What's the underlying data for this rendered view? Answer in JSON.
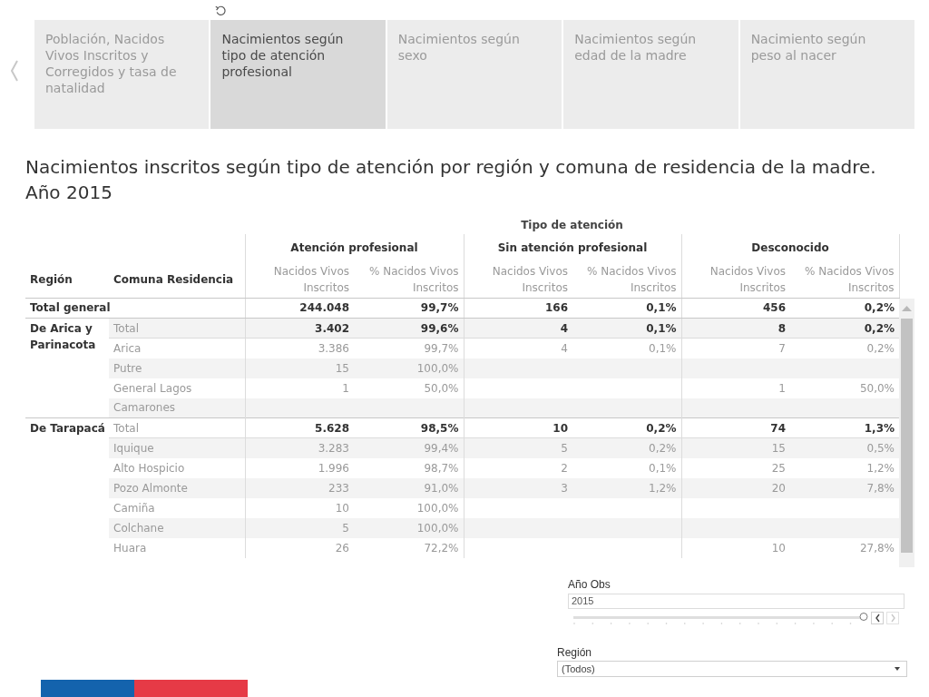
{
  "tabs": [
    {
      "label": "Población, Nacidos Vivos Inscritos y Corregidos y tasa de natalidad",
      "selected": false
    },
    {
      "label": "Nacimientos según tipo de atención profesional",
      "selected": true
    },
    {
      "label": "Nacimientos según sexo",
      "selected": false
    },
    {
      "label": "Nacimientos según edad de la madre",
      "selected": false
    },
    {
      "label": "Nacimiento según peso al nacer",
      "selected": false
    }
  ],
  "title_lines": [
    "Nacimientos inscritos según tipo de atención por región y comuna de residencia de la madre.",
    "Año 2015"
  ],
  "table": {
    "super_header": "Tipo de atención",
    "row_headers": [
      "Región",
      "Comuna Residencia"
    ],
    "groups": [
      {
        "label": "Atención profesional",
        "measures": [
          "Nacidos Vivos Inscritos",
          "% Nacidos Vivos Inscritos"
        ]
      },
      {
        "label": "Sin atención profesional",
        "measures": [
          "Nacidos Vivos Inscritos",
          "% Nacidos Vivos Inscritos"
        ]
      },
      {
        "label": "Desconocido",
        "measures": [
          "Nacidos Vivos Inscritos",
          "% Nacidos Vivos Inscritos"
        ]
      }
    ],
    "grand_total": {
      "label": "Total general",
      "profesional": {
        "count": "244.048",
        "percent": "99,7%"
      },
      "sin_profesional": {
        "count": "166",
        "percent": "0,1%"
      },
      "desconocido": {
        "count": "456",
        "percent": "0,2%"
      }
    },
    "regions": [
      {
        "region": "De Arica y Parinacota",
        "rows": [
          {
            "comuna": "Total",
            "kind": "subtotal",
            "profesional": {
              "count": "3.402",
              "percent": "99,6%"
            },
            "sin_profesional": {
              "count": "4",
              "percent": "0,1%"
            },
            "desconocido": {
              "count": "8",
              "percent": "0,2%"
            }
          },
          {
            "comuna": "Arica",
            "kind": "comuna",
            "profesional": {
              "count": "3.386",
              "percent": "99,7%"
            },
            "sin_profesional": {
              "count": "4",
              "percent": "0,1%"
            },
            "desconocido": {
              "count": "7",
              "percent": "0,2%"
            }
          },
          {
            "comuna": "Putre",
            "kind": "comuna",
            "profesional": {
              "count": "15",
              "percent": "100,0%"
            }
          },
          {
            "comuna": "General Lagos",
            "kind": "comuna",
            "profesional": {
              "count": "1",
              "percent": "50,0%"
            },
            "desconocido": {
              "count": "1",
              "percent": "50,0%"
            }
          },
          {
            "comuna": "Camarones",
            "kind": "comuna"
          }
        ]
      },
      {
        "region": "De Tarapacá",
        "rows": [
          {
            "comuna": "Total",
            "kind": "subtotal",
            "profesional": {
              "count": "5.628",
              "percent": "98,5%"
            },
            "sin_profesional": {
              "count": "10",
              "percent": "0,2%"
            },
            "desconocido": {
              "count": "74",
              "percent": "1,3%"
            }
          },
          {
            "comuna": "Iquique",
            "kind": "comuna",
            "profesional": {
              "count": "3.283",
              "percent": "99,4%"
            },
            "sin_profesional": {
              "count": "5",
              "percent": "0,2%"
            },
            "desconocido": {
              "count": "15",
              "percent": "0,5%"
            }
          },
          {
            "comuna": "Alto Hospicio",
            "kind": "comuna",
            "profesional": {
              "count": "1.996",
              "percent": "98,7%"
            },
            "sin_profesional": {
              "count": "2",
              "percent": "0,1%"
            },
            "desconocido": {
              "count": "25",
              "percent": "1,2%"
            }
          },
          {
            "comuna": "Pozo Almonte",
            "kind": "comuna",
            "profesional": {
              "count": "233",
              "percent": "91,0%"
            },
            "sin_profesional": {
              "count": "3",
              "percent": "1,2%"
            },
            "desconocido": {
              "count": "20",
              "percent": "7,8%"
            }
          },
          {
            "comuna": "Camiña",
            "kind": "comuna",
            "profesional": {
              "count": "10",
              "percent": "100,0%"
            }
          },
          {
            "comuna": "Colchane",
            "kind": "comuna",
            "profesional": {
              "count": "5",
              "percent": "100,0%"
            }
          },
          {
            "comuna": "Huara",
            "kind": "comuna",
            "profesional": {
              "count": "26",
              "percent": "72,2%"
            },
            "desconocido": {
              "count": "10",
              "percent": "27,8%"
            }
          }
        ]
      }
    ]
  },
  "filters": {
    "year": {
      "label": "Año Obs",
      "value": "2015",
      "level": 1,
      "buttons": [
        {
          "kind": "previous",
          "disabled": false
        },
        {
          "kind": "next",
          "disabled": true
        }
      ]
    },
    "region": {
      "label": "Región",
      "value": "(Todos)"
    }
  }
}
